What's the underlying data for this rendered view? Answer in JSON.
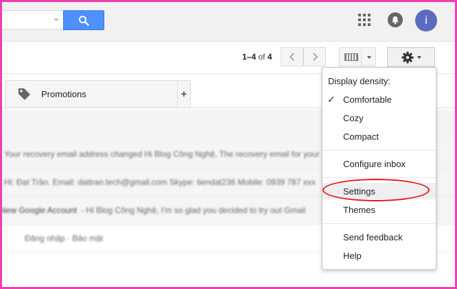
{
  "header": {
    "search": {
      "value": "",
      "placeholder": ""
    },
    "avatar_letter": "i"
  },
  "toolbar": {
    "pagination": {
      "range": "1–4",
      "of_label": "of",
      "total": "4"
    }
  },
  "tabs": [
    {
      "label": "Promotions"
    }
  ],
  "add_tab_label": "+",
  "email_rows": [
    {
      "sender": "",
      "text": "Your recovery email address changed Hi Blog Công Nghệ, The recovery email for your"
    },
    {
      "sender": "",
      "text": "Hi: Đạt Trần. Email: dattran.tech@gmail.com Skype: tiendat236 Mobile: 0939 787 xxx"
    },
    {
      "sender": "New Google Account",
      "text": "- Hi Blog Công Nghệ, I'm so glad you decided to try out Gmail"
    },
    {
      "sender": "",
      "text": "Đăng nhập · Bảo mật"
    }
  ],
  "settings_menu": {
    "header": "Display density:",
    "density_options": [
      {
        "label": "Comfortable",
        "selected": true
      },
      {
        "label": "Cozy",
        "selected": false
      },
      {
        "label": "Compact",
        "selected": false
      }
    ],
    "configure_inbox": "Configure inbox",
    "settings": "Settings",
    "themes": "Themes",
    "send_feedback": "Send feedback",
    "help": "Help"
  },
  "colors": {
    "frame_border": "#ef3fb0",
    "search_button": "#4d90fe",
    "avatar": "#5c6bc0",
    "highlight_ellipse": "#e8141a"
  }
}
